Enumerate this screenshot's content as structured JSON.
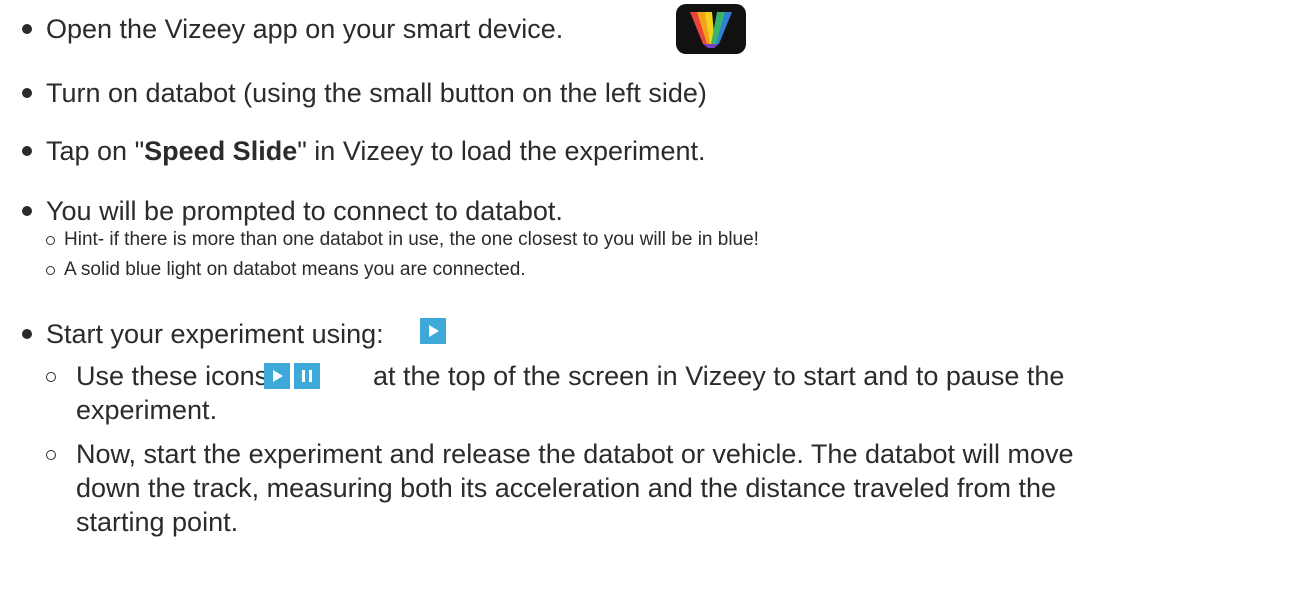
{
  "steps": [
    {
      "text": "Open the Vizeey app on your smart device.",
      "icon": "vizeey-app-icon"
    },
    {
      "text": "Turn on databot (using the small button on the left side)"
    },
    {
      "prefix": "Tap on \"",
      "bold": "Speed Slide",
      "suffix": "\" in Vizeey to load the experiment."
    },
    {
      "text": "You will be prompted to connect to databot.",
      "subitems": [
        "Hint- if there is more than one databot in use, the one closest to you will be in blue!",
        "A solid blue light on databot means you are connected."
      ]
    },
    {
      "text": "Start your experiment using:",
      "icon": "play-icon",
      "subitems": [
        {
          "before": "Use these icons",
          "after": "at the top of the screen in Vizeey to start and to pause the",
          "continuation": "experiment."
        },
        {
          "lines": [
            "Now, start the experiment and release the databot or vehicle. The databot will move",
            "down the track, measuring both its acceleration and the distance traveled from the",
            "starting point."
          ]
        }
      ]
    }
  ],
  "colors": {
    "text": "#2b2b2b",
    "icon_blue": "#3ea9d8",
    "app_icon_bg": "#111111"
  }
}
